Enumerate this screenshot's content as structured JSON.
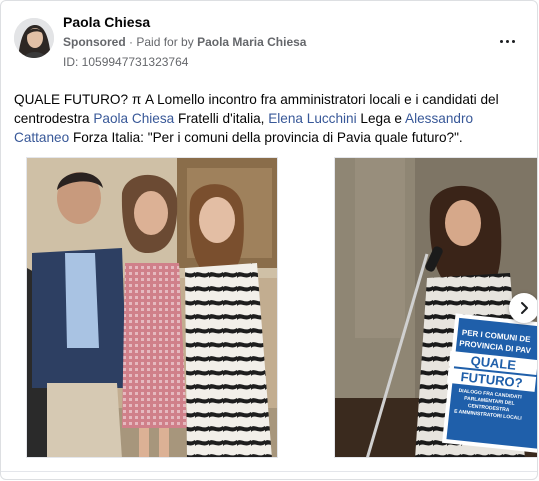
{
  "post": {
    "author": "Paola Chiesa",
    "sponsored": "Sponsored",
    "paid_for_prefix": "Paid for by",
    "payer": "Paola Maria Chiesa",
    "ad_id": "ID: 1059947731323764",
    "text": {
      "t1": "QUALE FUTURO? π A Lomello incontro fra amministratori locali e i candidati del centrodestra ",
      "link1": "Paola Chiesa",
      "t2": " Fratelli d'italia, ",
      "link2": "Elena Lucchini",
      "t3": " Lega e ",
      "link3": "Alessandro Cattaneo",
      "t4": " Forza Italia: \"Per i comuni della provincia di Pavia quale futuro?\"."
    },
    "carousel": {
      "sign": {
        "l1": "PER I COMUNI DE",
        "l2": "PROVINCIA DI PAV",
        "l3": "QUALE",
        "l4": "FUTURO?",
        "l5": "DIALOGO FRA CANDIDATI",
        "l6": "PARLAMENTARI DEL CENTRODESTRA",
        "l7": "E AMMINISTRATORI LOCALI"
      }
    }
  },
  "icons": [
    "more-options-icon",
    "chevron-right-icon"
  ],
  "colors": {
    "link": "#385898",
    "secondary_text": "#65676b",
    "sign_blue": "#1f5faa"
  }
}
